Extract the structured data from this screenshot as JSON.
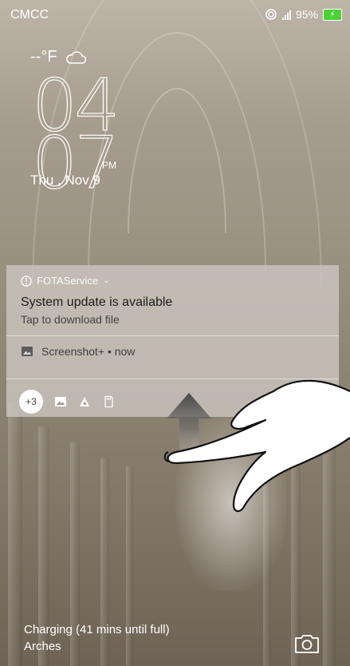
{
  "status_bar": {
    "carrier": "CMCC",
    "battery_percent": "95%"
  },
  "clock": {
    "temperature": "--°F",
    "hour": "04",
    "minute": "07",
    "ampm": "PM",
    "date": "Thu , Nov 9"
  },
  "notifications": [
    {
      "app": "FOTAService",
      "title": "System update is available",
      "text": "Tap to download file"
    },
    {
      "app": "Screenshot+",
      "time": "now"
    }
  ],
  "overflow": {
    "count_label": "+3",
    "icons": [
      "image-icon",
      "app-icon",
      "sd-card-icon"
    ]
  },
  "footer": {
    "charging_text": "Charging (41 mins until full)",
    "wallpaper_name": "Arches"
  },
  "colors": {
    "battery": "#4cd137",
    "notification_bg": "#cdc8c2"
  }
}
